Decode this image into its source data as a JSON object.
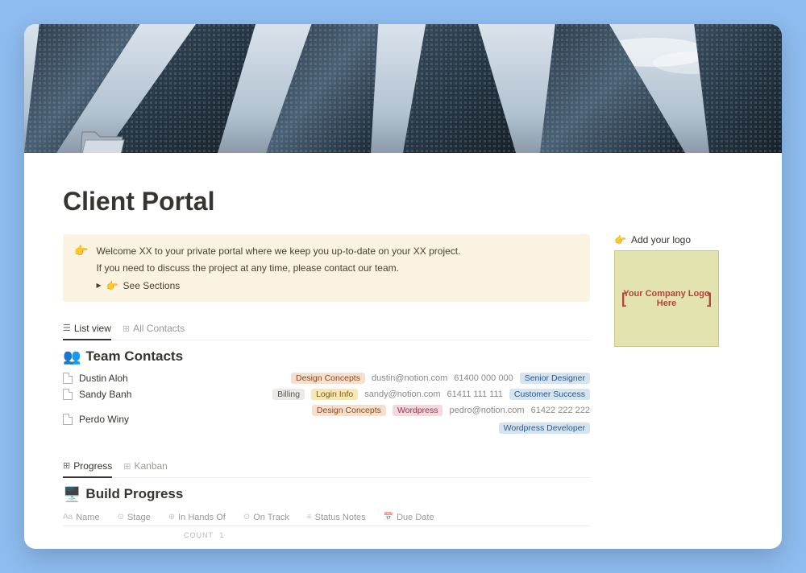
{
  "page": {
    "title": "Client Portal"
  },
  "folder_emoji": "📂",
  "callout": {
    "emoji": "👉",
    "line1": "Welcome XX to your private portal where we keep you up-to-date on your XX project.",
    "line2": "If you need to discuss the project at any time, please contact our team.",
    "toggle_emoji": "👉",
    "toggle_label": "See Sections"
  },
  "logo": {
    "emoji": "👉",
    "label": "Add your logo",
    "placeholder_text": "Your Company Logo Here"
  },
  "contacts_tabs": [
    {
      "label": "List view",
      "active": true
    },
    {
      "label": "All Contacts",
      "active": false
    }
  ],
  "contacts": {
    "title_emoji": "👥",
    "title": "Team Contacts",
    "rows": [
      {
        "name": "Dustin Aloh",
        "tags": [
          {
            "text": "Design Concepts",
            "color": "orange"
          }
        ],
        "email": "dustin@notion.com",
        "phone": "61400 000 000",
        "role": {
          "text": "Senior Designer",
          "color": "blue"
        }
      },
      {
        "name": "Sandy Banh",
        "tags": [
          {
            "text": "Billing",
            "color": "gray"
          },
          {
            "text": "Login Info",
            "color": "yellow"
          }
        ],
        "email": "sandy@notion.com",
        "phone": "61411 111 111",
        "role": {
          "text": "Customer Success",
          "color": "blue"
        }
      },
      {
        "name": "Perdo Winy",
        "tags": [
          {
            "text": "Design Concepts",
            "color": "orange"
          },
          {
            "text": "Wordpress",
            "color": "pink"
          }
        ],
        "email": "pedro@notion.com",
        "phone": "61422 222 222",
        "role": {
          "text": "Wordpress Developer",
          "color": "blue"
        }
      }
    ]
  },
  "progress_tabs": [
    {
      "label": "Progress",
      "active": true
    },
    {
      "label": "Kanban",
      "active": false
    }
  ],
  "build": {
    "title_emoji": "🖥️",
    "title": "Build Progress",
    "columns": [
      {
        "icon": "Aa",
        "label": "Name"
      },
      {
        "icon": "⊙",
        "label": "Stage"
      },
      {
        "icon": "⊕",
        "label": "In Hands Of"
      },
      {
        "icon": "⊙",
        "label": "On Track"
      },
      {
        "icon": "≡",
        "label": "Status Notes"
      },
      {
        "icon": "📅",
        "label": "Due Date"
      }
    ],
    "count_label": "COUNT",
    "count_value": "1"
  }
}
